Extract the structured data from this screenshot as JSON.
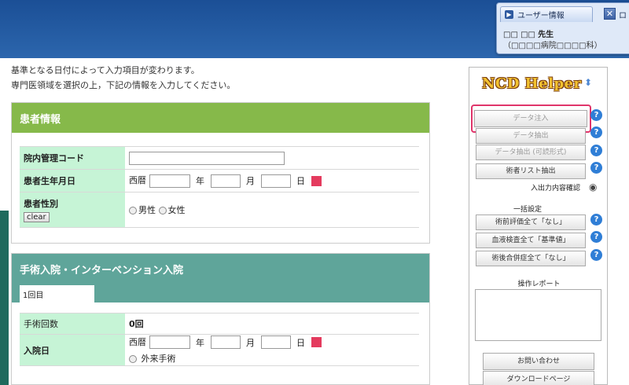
{
  "header": {
    "user_tab_label": "ユーザー情報",
    "close_glyph": "✕",
    "logout_label": "ロ",
    "user_name": "□□ □□",
    "user_suffix": "先生",
    "hospital": "（□□□□病院□□□□科）"
  },
  "intro": {
    "line1": "基準となる日付によって入力項目が変わります。",
    "line2": "専門医領域を選択の上，下記の情報を入力してください。"
  },
  "patient": {
    "title": "患者情報",
    "id_label": "院内管理コード",
    "dob_label": "患者生年月日",
    "era": "西暦",
    "year": "年",
    "month": "月",
    "day": "日",
    "sex_label": "患者性別",
    "clear": "clear",
    "male": "男性",
    "female": "女性"
  },
  "surgery": {
    "title": "手術入院・インターベンション入院",
    "round_tab": "1回目",
    "count_label": "手術回数",
    "count_value": "0回",
    "admit_label": "入院日",
    "era": "西暦",
    "year": "年",
    "month": "月",
    "day": "日",
    "outpatient": "外来手術"
  },
  "helper": {
    "logo": "NCD Helper",
    "btn_inject": "データ注入",
    "btn_extract": "データ抽出",
    "btn_extract_edit": "データ抽出 (可読形式)",
    "btn_surgeon": "術者リスト抽出",
    "io_confirm": "入出力内容確認",
    "bulk_label": "一括設定",
    "btn_bulk1": "術前評価全て「なし」",
    "btn_bulk2": "血液検査全て「基準値」",
    "btn_bulk3": "術後合併症全て「なし」",
    "report_label": "操作レポート",
    "btn_contact": "お問い合わせ",
    "btn_download": "ダウンロードページ",
    "help_glyph": "?"
  },
  "colors": {
    "header_blue": "#1b4f96",
    "patient_green": "#86b94a",
    "surgery_teal": "#5fa59a",
    "label_mint": "#c6f4d6",
    "focus_pink": "#e0356b"
  }
}
